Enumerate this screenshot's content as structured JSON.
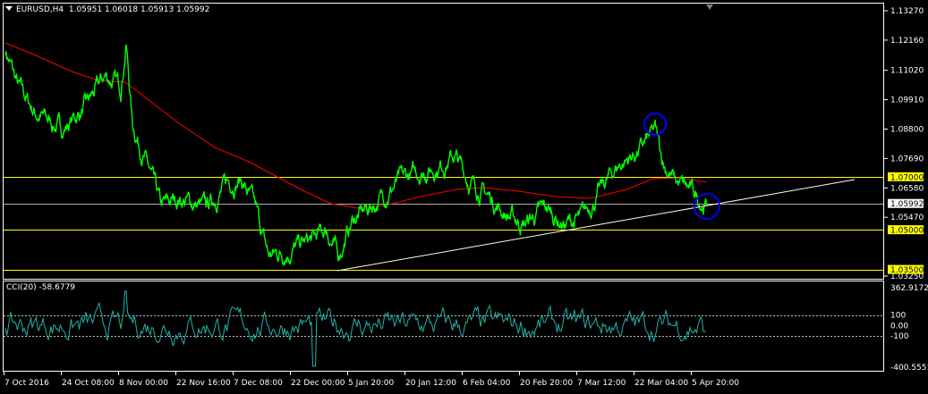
{
  "header": {
    "symbol_timeframe": "EURUSD,H4",
    "ohlc": "1.05951 1.06018 1.05913 1.05992"
  },
  "price_axis": {
    "labels": [
      {
        "text": "1.13270",
        "value": 1.1327
      },
      {
        "text": "1.12160",
        "value": 1.1216
      },
      {
        "text": "1.11020",
        "value": 1.1102
      },
      {
        "text": "1.09910",
        "value": 1.0991
      },
      {
        "text": "1.08800",
        "value": 1.088
      },
      {
        "text": "1.07690",
        "value": 1.0769
      },
      {
        "text": "1.06580",
        "value": 1.0658
      },
      {
        "text": "1.05470",
        "value": 1.0547
      },
      {
        "text": "1.03250",
        "value": 1.0325
      }
    ],
    "highlighted": [
      {
        "text": "1.07000",
        "value": 1.07,
        "style": "yellow"
      },
      {
        "text": "1.05992",
        "value": 1.05992,
        "style": "white"
      },
      {
        "text": "1.05000",
        "value": 1.05,
        "style": "yellow"
      },
      {
        "text": "1.03500",
        "value": 1.035,
        "style": "yellow"
      }
    ]
  },
  "horizontal_levels": [
    1.07,
    1.05992,
    1.05,
    1.035
  ],
  "time_axis": {
    "labels": [
      "7 Oct 2016",
      "24 Oct 08:00",
      "8 Nov 00:00",
      "22 Nov 16:00",
      "7 Dec 08:00",
      "22 Dec 00:00",
      "5 Jan 20:00",
      "20 Jan 12:00",
      "6 Feb 04:00",
      "20 Feb 20:00",
      "7 Mar 12:00",
      "22 Mar 04:00",
      "5 Apr 20:00"
    ]
  },
  "cci": {
    "title": "CCI(20) -58.6779",
    "axis_labels": [
      {
        "text": "362.9172",
        "value": 362.9172
      },
      {
        "text": "100",
        "value": 100
      },
      {
        "text": "0.00",
        "value": 0
      },
      {
        "text": "-100",
        "value": -100
      },
      {
        "text": "-400.5551",
        "value": -400.5551
      }
    ],
    "levels": [
      100,
      -100
    ]
  },
  "colors": {
    "background": "#000000",
    "price_line": "#00ff00",
    "moving_average": "#ff0000",
    "cci_line": "#20b2aa",
    "level_yellow": "#ffff00",
    "trendline": "#ffffe0",
    "circle": "#0000ff",
    "frame": "#ffffff"
  },
  "chart_data": {
    "type": "line",
    "series": [
      {
        "name": "EURUSD,H4",
        "x": [
          "7 Oct 2016",
          "24 Oct 08:00",
          "8 Nov 00:00",
          "22 Nov 16:00",
          "7 Dec 08:00",
          "22 Dec 00:00",
          "5 Jan 20:00",
          "20 Jan 12:00",
          "6 Feb 04:00",
          "20 Feb 20:00",
          "7 Mar 12:00",
          "22 Mar 04:00",
          "5 Apr 20:00"
        ],
        "values": [
          1.118,
          1.097,
          1.105,
          1.058,
          1.07,
          1.045,
          1.055,
          1.072,
          1.073,
          1.058,
          1.062,
          1.083,
          1.06
        ]
      }
    ],
    "ylim": [
      1.0315,
      1.1335
    ]
  }
}
